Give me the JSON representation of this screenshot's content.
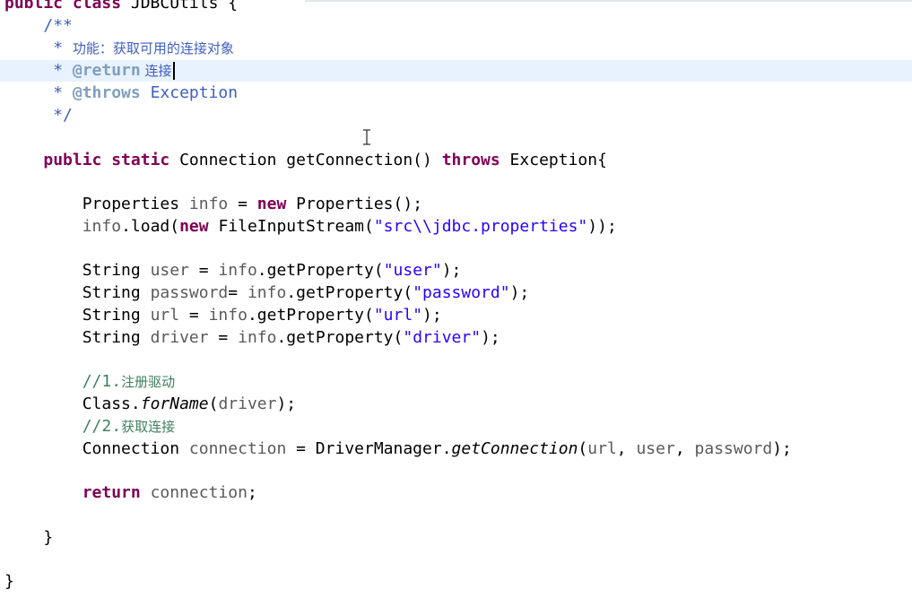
{
  "code": {
    "class_decl": {
      "kw": "public class",
      "name": " JDBCUtils {"
    },
    "doc_open": "/**",
    "doc_desc_prefix": " * ",
    "doc_desc_text": "功能：获取可用的连接对象",
    "doc_return_prefix": " * ",
    "doc_return_tag": "@return",
    "doc_return_text": " 连接",
    "doc_throws_prefix": " * ",
    "doc_throws_tag": "@throws",
    "doc_throws_text": " Exception",
    "doc_close": " */",
    "method_kw": "public static",
    "method_sig": " Connection getConnection() ",
    "method_throws_kw": "throws",
    "method_tail": " Exception{",
    "l_props_type": "Properties ",
    "l_props_var": "info",
    "l_props_eq": " = ",
    "l_props_new": "new",
    "l_props_tail": " Properties();",
    "l_load_var": "info",
    "l_load_mid": ".load(",
    "l_load_new": "new",
    "l_load_ctor": " FileInputStream(",
    "l_load_str": "\"src\\\\jdbc.properties\"",
    "l_load_tail": "));",
    "l_user_type": "String ",
    "l_user_var": "user",
    "l_user_eq": " = ",
    "l_user_info": "info",
    "l_user_call": ".getProperty(",
    "l_user_str": "\"user\"",
    "l_user_tail": ");",
    "l_pwd_type": "String ",
    "l_pwd_var": "password",
    "l_pwd_eq": "= ",
    "l_pwd_info": "info",
    "l_pwd_call": ".getProperty(",
    "l_pwd_str": "\"password\"",
    "l_pwd_tail": ");",
    "l_url_type": "String ",
    "l_url_var": "url",
    "l_url_eq": " = ",
    "l_url_info": "info",
    "l_url_call": ".getProperty(",
    "l_url_str": "\"url\"",
    "l_url_tail": ");",
    "l_drv_type": "String ",
    "l_drv_var": "driver",
    "l_drv_eq": " = ",
    "l_drv_info": "info",
    "l_drv_call": ".getProperty(",
    "l_drv_str": "\"driver\"",
    "l_drv_tail": ");",
    "c1_prefix": "//1.",
    "c1_text": "注册驱动",
    "l_cls_head": "Class.",
    "l_cls_method": "forName",
    "l_cls_open": "(",
    "l_cls_arg": "driver",
    "l_cls_tail": ");",
    "c2_prefix": "//2.",
    "c2_text": "获取连接",
    "l_conn_type": "Connection ",
    "l_conn_var": "connection",
    "l_conn_mid": " = DriverManager.",
    "l_conn_method": "getConnection",
    "l_conn_open": "(",
    "l_conn_a1": "url",
    "l_conn_c1": ", ",
    "l_conn_a2": "user",
    "l_conn_c2": ", ",
    "l_conn_a3": "password",
    "l_conn_tail": ");",
    "l_ret_kw": "return",
    "l_ret_sp": " ",
    "l_ret_var": "connection",
    "l_ret_tail": ";",
    "method_close": "}",
    "class_close": "}"
  },
  "colors": {
    "keyword": "#7f0055",
    "string": "#2a00ff",
    "comment": "#3f7f5f",
    "javadoc": "#3f5fbf",
    "javadoc_tag": "#7f9fbf",
    "current_line": "#e8f2fe"
  },
  "icons": {
    "cursor": "ibeam-cursor-icon"
  }
}
